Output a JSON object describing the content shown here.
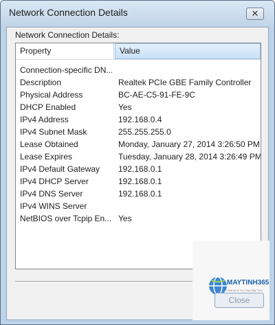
{
  "window": {
    "title": "Network Connection Details",
    "close_glyph": "✕"
  },
  "label": "Network Connection Details:",
  "table": {
    "headers": [
      "Property",
      "Value"
    ],
    "rows": [
      {
        "property": "Connection-specific DN...",
        "value": ""
      },
      {
        "property": "Description",
        "value": "Realtek PCIe GBE Family Controller"
      },
      {
        "property": "Physical Address",
        "value": "BC-AE-C5-91-FE-9C"
      },
      {
        "property": "DHCP Enabled",
        "value": "Yes"
      },
      {
        "property": "IPv4 Address",
        "value": "192.168.0.4"
      },
      {
        "property": "IPv4 Subnet Mask",
        "value": "255.255.255.0"
      },
      {
        "property": "Lease Obtained",
        "value": "Monday, January 27, 2014 3:26:50 PM"
      },
      {
        "property": "Lease Expires",
        "value": "Tuesday, January 28, 2014 3:26:49 PM"
      },
      {
        "property": "IPv4 Default Gateway",
        "value": "192.168.0.1"
      },
      {
        "property": "IPv4 DHCP Server",
        "value": "192.168.0.1"
      },
      {
        "property": "IPv4 DNS Server",
        "value": "192.168.0.1"
      },
      {
        "property": "IPv4 WINS Server",
        "value": ""
      },
      {
        "property": "NetBIOS over Tcpip En...",
        "value": "Yes"
      }
    ]
  },
  "watermark": {
    "brand": "MAYTINH365",
    "tagline": "Chia sẻ & Trợ Giúp Máy Tính",
    "icon": "globe-icon"
  },
  "footer": {
    "close_label": "Close"
  },
  "colors": {
    "header_highlight": "#c9e1f7",
    "brand": "#1a5fa8"
  }
}
